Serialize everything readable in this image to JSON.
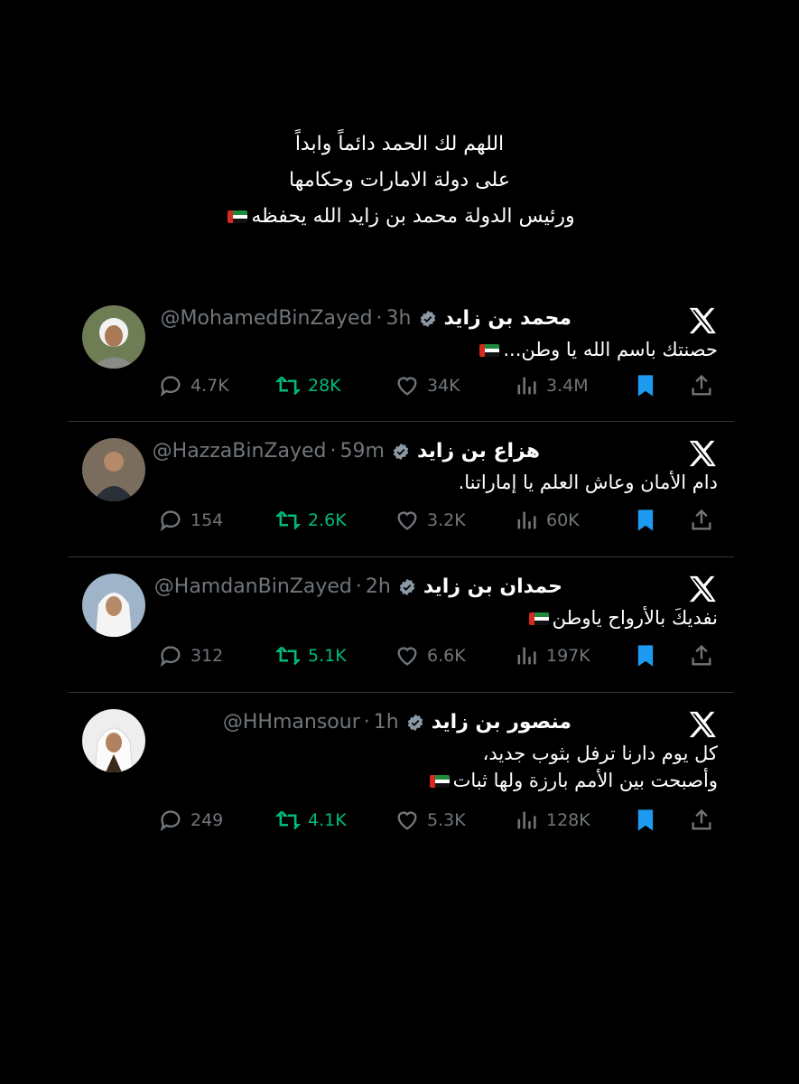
{
  "header": {
    "line1": "اللهم لك الحمد دائماً وابداً",
    "line2": "على دولة الامارات وحكامها",
    "line3": "ورئيس الدولة محمد بن زايد الله يحفظه"
  },
  "tweets": [
    {
      "name": "محمد بن زايد",
      "handle": "@MohamedBinZayed",
      "time": "3h",
      "text": "حصنتك باسم الله يا وطن...",
      "text2": "",
      "replies": "4.7K",
      "retweets": "28K",
      "likes": "34K",
      "views": "3.4M"
    },
    {
      "name": "هزاع بن زايد",
      "handle": "@HazzaBinZayed",
      "time": "59m",
      "text": "دام الأمان وعاش العلم يا إماراتنا.",
      "text2": "",
      "replies": "154",
      "retweets": "2.6K",
      "likes": "3.2K",
      "views": "60K"
    },
    {
      "name": "حمدان بن زايد",
      "handle": "@HamdanBinZayed",
      "time": "2h",
      "text": "نفديكَ بالأرواح ياوطن",
      "text2": "",
      "replies": "312",
      "retweets": "5.1K",
      "likes": "6.6K",
      "views": "197K"
    },
    {
      "name": "منصور بن زايد",
      "handle": "@HHmansour",
      "time": "1h",
      "text": "كل يوم دارنا ترفل بثوب جديد،",
      "text2": "وأصبحت بين الأمم بارزة ولها ثبات",
      "replies": "249",
      "retweets": "4.1K",
      "likes": "5.3K",
      "views": "128K"
    }
  ],
  "colors": {
    "background": "#000000",
    "text": "#ffffff",
    "muted": "#71767b",
    "retweet": "#00ba7c",
    "bookmark": "#1d9bf0",
    "verified": "#8b98a5"
  },
  "icons": [
    "x-logo-icon",
    "verified-badge-icon",
    "reply-icon",
    "retweet-icon",
    "like-icon",
    "views-icon",
    "bookmark-icon",
    "share-icon",
    "uae-flag-icon"
  ]
}
